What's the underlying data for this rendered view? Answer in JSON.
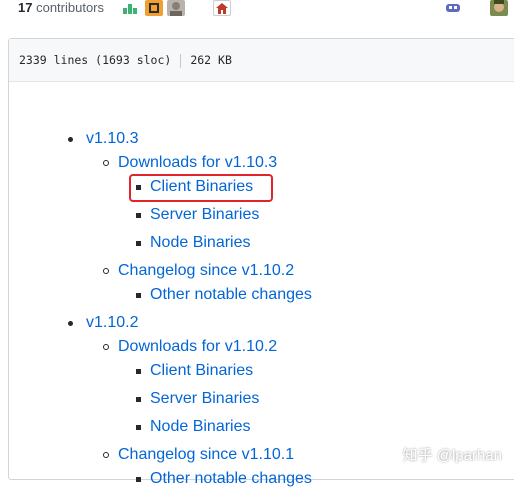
{
  "contributors": {
    "count": "17",
    "label": "contributors"
  },
  "file_header": {
    "lines": "2339 lines (1693 sloc)",
    "size": "262 KB"
  },
  "releases": [
    {
      "version": "v1.10.3",
      "downloads": "Downloads for v1.10.3",
      "binaries": [
        "Client Binaries",
        "Server Binaries",
        "Node Binaries"
      ],
      "changelog": "Changelog since v1.10.2",
      "changelog_items": [
        "Other notable changes"
      ]
    },
    {
      "version": "v1.10.2",
      "downloads": "Downloads for v1.10.2",
      "binaries": [
        "Client Binaries",
        "Server Binaries",
        "Node Binaries"
      ],
      "changelog": "Changelog since v1.10.1",
      "changelog_items": [
        "Other notable changes"
      ]
    }
  ],
  "watermark": "知乎 @lparhan",
  "colors": {
    "link": "#0366d6",
    "highlight": "#e1242c",
    "header_bg": "#f6f8fa",
    "border": "#d1d5da"
  }
}
